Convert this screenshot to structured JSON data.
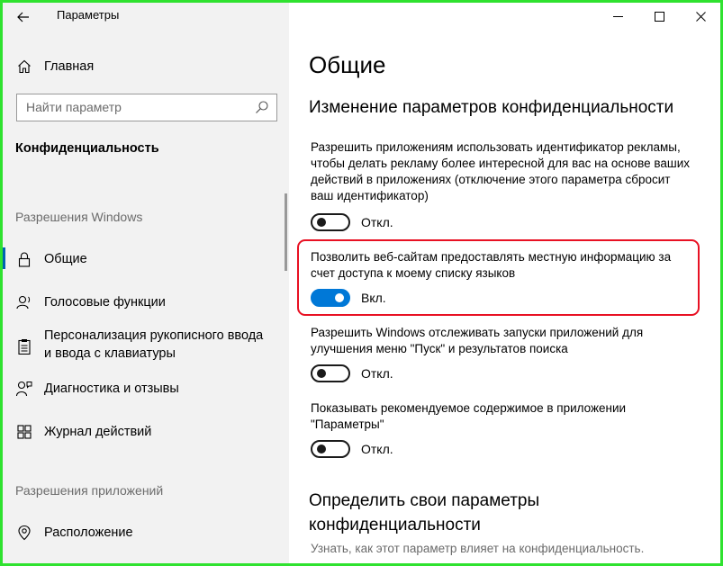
{
  "window": {
    "title": "Параметры"
  },
  "sidebar": {
    "home_label": "Главная",
    "search": {
      "placeholder": "Найти параметр"
    },
    "category": "Конфиденциальность",
    "section_windows": "Разрешения Windows",
    "items": [
      {
        "label": "Общие",
        "icon": "lock-icon",
        "active": true
      },
      {
        "label": "Голосовые функции",
        "icon": "voice-icon"
      },
      {
        "label": "Персонализация рукописного ввода и ввода с клавиатуры",
        "icon": "clipboard-icon"
      },
      {
        "label": "Диагностика и отзывы",
        "icon": "person-feedback-icon"
      },
      {
        "label": "Журнал действий",
        "icon": "activity-history-icon"
      }
    ],
    "section_apps": "Разрешения приложений",
    "app_items": [
      {
        "label": "Расположение",
        "icon": "location-icon"
      }
    ]
  },
  "main": {
    "title": "Общие",
    "subtitle": "Изменение параметров конфиденциальности",
    "settings": [
      {
        "description": "Разрешить приложениям использовать идентификатор рекламы, чтобы делать рекламу более интересной для вас на основе ваших действий в приложениях (отключение этого параметра сбросит ваш идентификатор)",
        "state": "Откл.",
        "on": false
      },
      {
        "description": "Позволить веб-сайтам предоставлять местную информацию за счет доступа к моему списку языков",
        "state": "Вкл.",
        "on": true
      },
      {
        "description": "Разрешить Windows отслеживать запуски приложений для улучшения меню \"Пуск\" и результатов поиска",
        "state": "Откл.",
        "on": false
      },
      {
        "description": "Показывать рекомендуемое содержимое в приложении \"Параметры\"",
        "state": "Откл.",
        "on": false
      }
    ],
    "section2_title": "Определить свои параметры конфиденциальности",
    "section2_text": "Узнать, как этот параметр влияет на конфиденциальность."
  },
  "colors": {
    "accent": "#0078d7",
    "highlight": "#e81123",
    "frame": "#2fe22f"
  }
}
